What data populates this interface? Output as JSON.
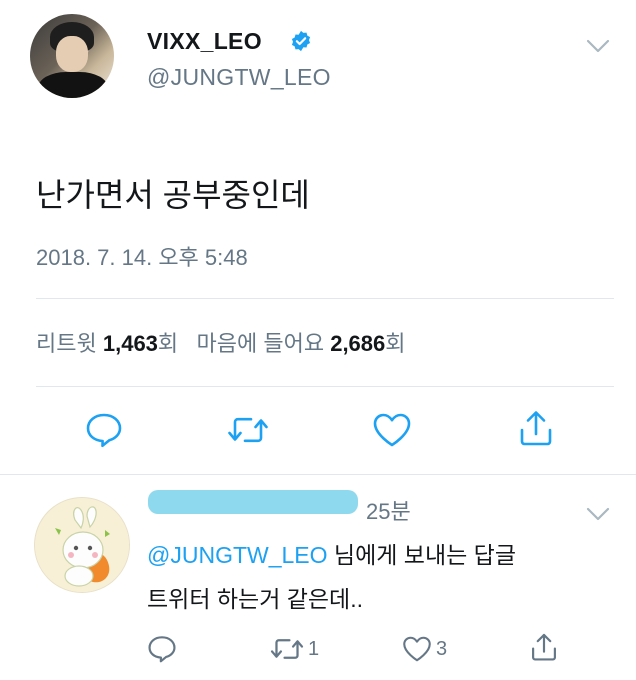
{
  "tweet": {
    "display_name": "VIXX_LEO",
    "handle": "@JUNGTW_LEO",
    "text": "난가면서 공부중인데",
    "timestamp": "2018. 7. 14. 오후 5:48",
    "retweet_label": "리트윗",
    "retweet_count": "1,463",
    "retweet_suffix": "회",
    "like_label": "마음에 들어요",
    "like_count": "2,686",
    "like_suffix": "회"
  },
  "reply": {
    "time": "25분",
    "mention": "@JUNGTW_LEO",
    "reply_to_suffix": " 님에게 보내는 답글",
    "text": "트위터 하는거 같은데..",
    "retweet_count": "1",
    "like_count": "3"
  },
  "colors": {
    "accent": "#1da1f2",
    "muted": "#657786",
    "icon": "#1da1f2",
    "divider": "#e1e8ed"
  },
  "icons": [
    "verified-badge-icon",
    "chevron-down-icon",
    "reply-icon",
    "retweet-icon",
    "heart-icon",
    "share-icon"
  ]
}
